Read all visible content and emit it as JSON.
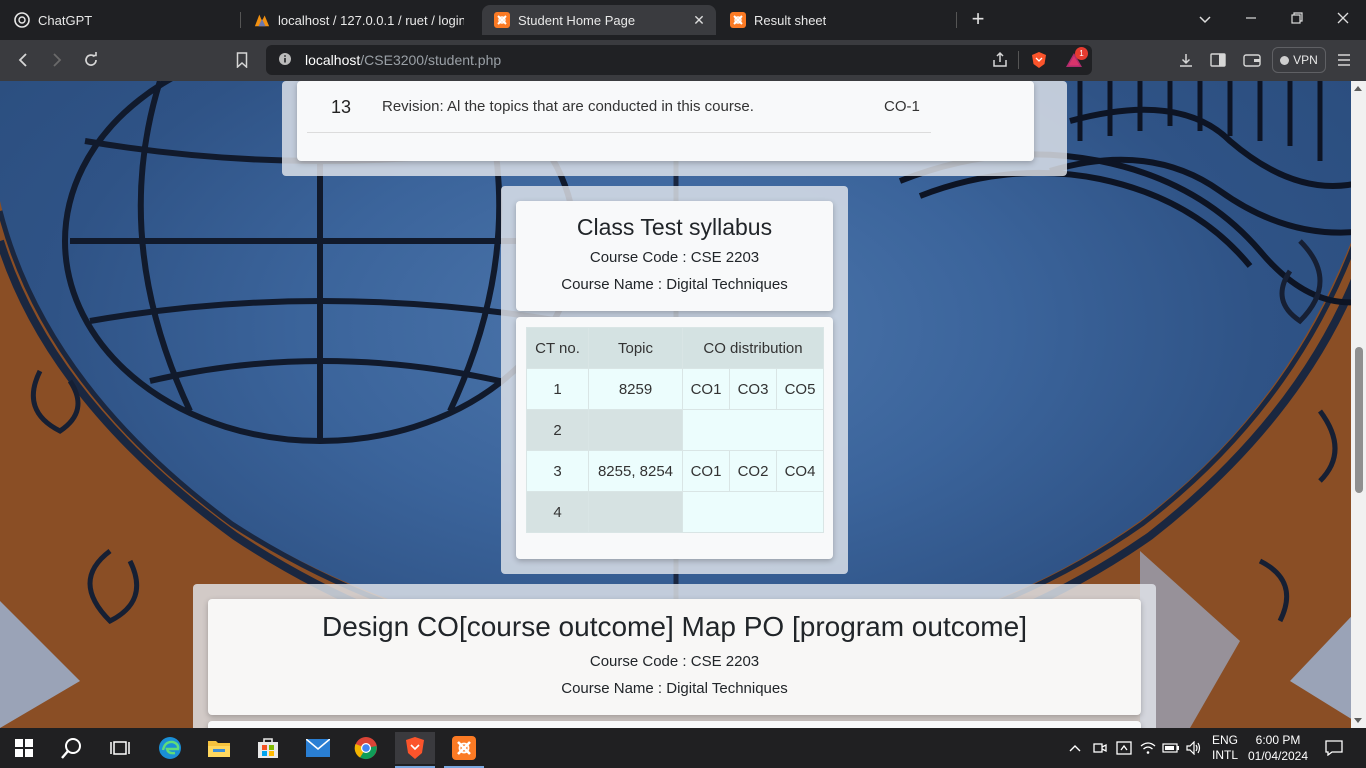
{
  "browser": {
    "tabs": [
      {
        "title": "ChatGPT",
        "icon": "chatgpt-icon",
        "active": false
      },
      {
        "title": "localhost / 127.0.0.1 / ruet / login | p",
        "icon": "phpmyadmin-icon",
        "active": false
      },
      {
        "title": "Student Home Page",
        "icon": "xampp-icon",
        "active": true
      },
      {
        "title": "Result sheet",
        "icon": "xampp-icon",
        "active": false
      }
    ],
    "address": {
      "host": "localhost",
      "path": "/CSE3200/student.php"
    },
    "vpn_label": "VPN",
    "shields_badge": "1"
  },
  "page": {
    "syllabus_last_row": {
      "number": "13",
      "topic": "Revision: Al the topics that are conducted in this course.",
      "co": "CO-1"
    },
    "class_test": {
      "title": "Class Test syllabus",
      "course_code": "Course Code : CSE 2203",
      "course_name": "Course Name : Digital Techniques",
      "headers": [
        "CT no.",
        "Topic",
        "CO distribution"
      ],
      "rows": [
        {
          "ct": "1",
          "topic": "8259",
          "cos": [
            "CO1",
            "CO3",
            "CO5"
          ]
        },
        {
          "ct": "2",
          "topic": "",
          "cos": []
        },
        {
          "ct": "3",
          "topic": "8255, 8254",
          "cos": [
            "CO1",
            "CO2",
            "CO4"
          ]
        },
        {
          "ct": "4",
          "topic": "",
          "cos": []
        }
      ]
    },
    "co_po": {
      "title": "Design CO[course outcome] Map PO [program outcome]",
      "course_code": "Course Code : CSE 2203",
      "course_name": "Course Name : Digital Techniques"
    }
  },
  "taskbar": {
    "language": "ENG",
    "layout": "INTL",
    "time": "6:00 PM",
    "date": "01/04/2024",
    "apps": [
      "start-icon",
      "search-icon",
      "task-view-icon",
      "edge-icon",
      "file-explorer-icon",
      "store-icon",
      "mail-icon",
      "chrome-icon",
      "brave-icon",
      "xampp-icon"
    ]
  },
  "colors": {
    "accent": "#e2582a",
    "page_blue": "#3b649b"
  }
}
